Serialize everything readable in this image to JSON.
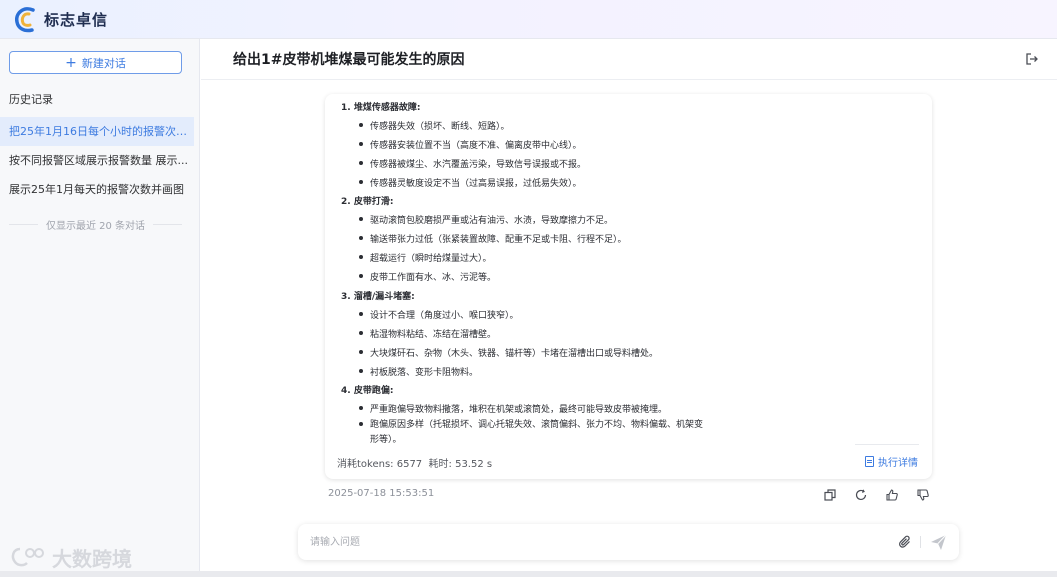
{
  "brand": {
    "name": "标志卓信"
  },
  "sidebar": {
    "new_chat_label": "新建对话",
    "history_title": "历史记录",
    "items": [
      {
        "label": "把25年1月16日每个小时的报警次数..."
      },
      {
        "label": "按不同报警区域展示报警数量 展示..."
      },
      {
        "label": "展示25年1月每天的报警次数并画图"
      }
    ],
    "note": "仅显示最近 20 条对话",
    "watermark": "大数跨境"
  },
  "header": {
    "title": "给出1#皮带机堆煤最可能发生的原因"
  },
  "answer": {
    "sections": [
      {
        "title": "1. 堆煤传感器故障:",
        "bullets": [
          "传感器失效（损坏、断线、短路）。",
          "传感器安装位置不当（高度不准、偏离皮带中心线）。",
          "传感器被煤尘、水汽覆盖污染，导致信号误报或不报。",
          "传感器灵敏度设定不当（过高易误报，过低易失效）。"
        ]
      },
      {
        "title": "2. 皮带打滑:",
        "bullets": [
          "驱动滚筒包胶磨损严重或沾有油污、水渍，导致摩擦力不足。",
          "输送带张力过低（张紧装置故障、配重不足或卡阻、行程不足）。",
          "超载运行（瞬时给煤量过大）。",
          "皮带工作面有水、冰、污泥等。"
        ]
      },
      {
        "title": "3. 溜槽/漏斗堵塞:",
        "bullets": [
          "设计不合理（角度过小、喉口狭窄）。",
          "粘湿物料粘结、冻结在溜槽壁。",
          "大块煤矸石、杂物（木头、铁器、锚杆等）卡堵在溜槽出口或导料槽处。",
          "衬板脱落、变形卡阻物料。"
        ]
      },
      {
        "title": "4. 皮带跑偏:",
        "bullets": [
          "严重跑偏导致物料撒落，堆积在机架或滚筒处，最终可能导致皮带被掩埋。",
          "跑偏原因多样（托辊损坏、调心托辊失效、滚筒偏斜、张力不均、物料偏载、机架变形等）。"
        ]
      }
    ],
    "tokens_text": "消耗tokens: 6577",
    "time_text": "耗时: 53.52 s",
    "exec_detail_label": "执行详情",
    "timestamp": "2025-07-18 15:53:51"
  },
  "input": {
    "placeholder": "请输入问题"
  },
  "colors": {
    "accent": "#3d7be0",
    "active_bg": "#e3ecfc"
  }
}
